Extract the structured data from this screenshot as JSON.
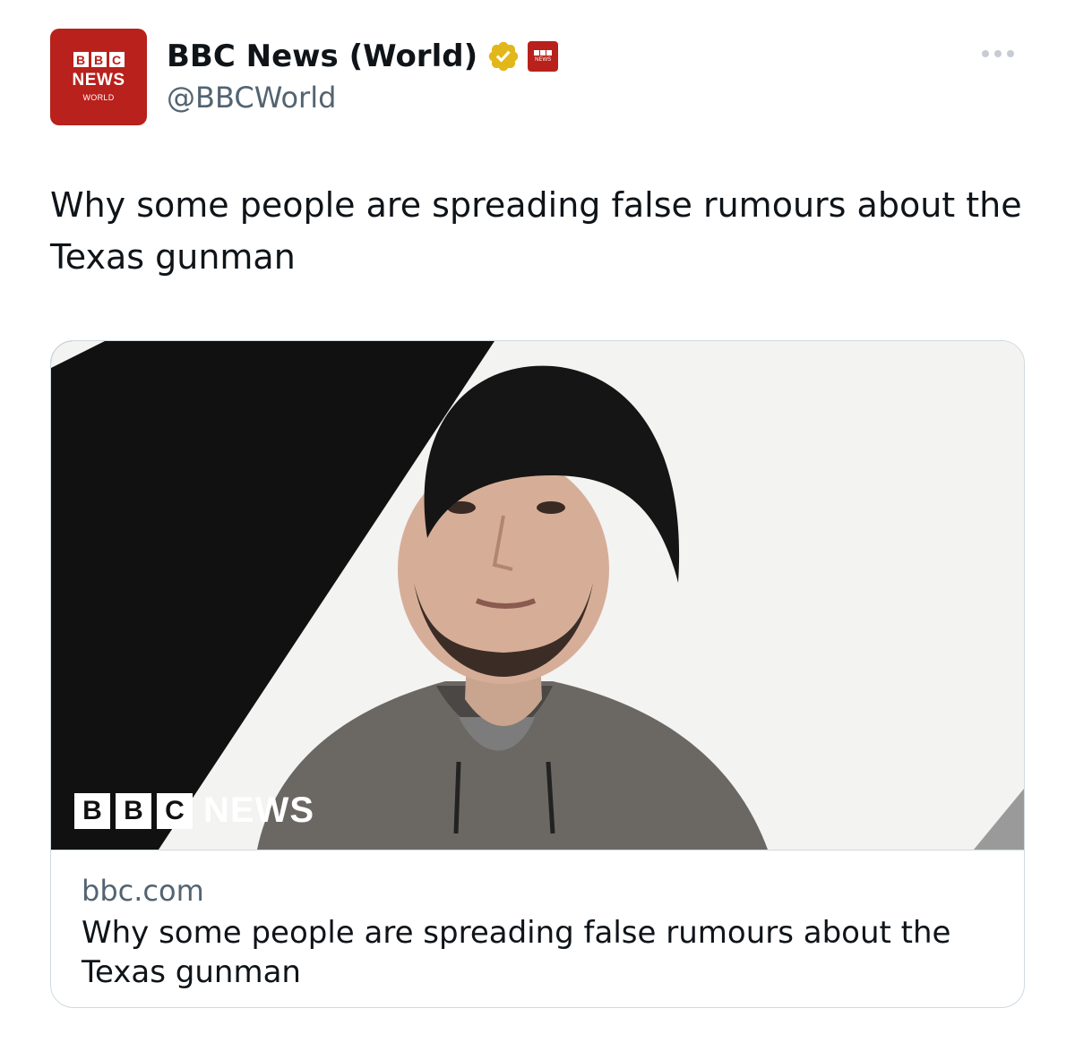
{
  "header": {
    "avatar": {
      "bbc_letters": [
        "B",
        "B",
        "C"
      ],
      "line1": "NEWS",
      "line2": "WORLD"
    },
    "display_name": "BBC News (World)",
    "handle": "@BBCWorld",
    "verified_icon": "verified-badge-icon",
    "affiliation_icon": "bbc-news-affiliate-icon",
    "more_icon": "more-options-icon"
  },
  "tweet": {
    "text": "Why some people are spreading false rumours about the Texas gunman"
  },
  "card": {
    "image_logo": {
      "letters": [
        "B",
        "B",
        "C"
      ],
      "word": "NEWS"
    },
    "domain": "bbc.com",
    "title": "Why some people are spreading false rumours about the Texas gunman"
  },
  "colors": {
    "bbc_red": "#b8211c",
    "verified_gold": "#e2b719",
    "text_primary": "#0f1419",
    "text_secondary": "#536471",
    "border": "#cfd9de"
  }
}
